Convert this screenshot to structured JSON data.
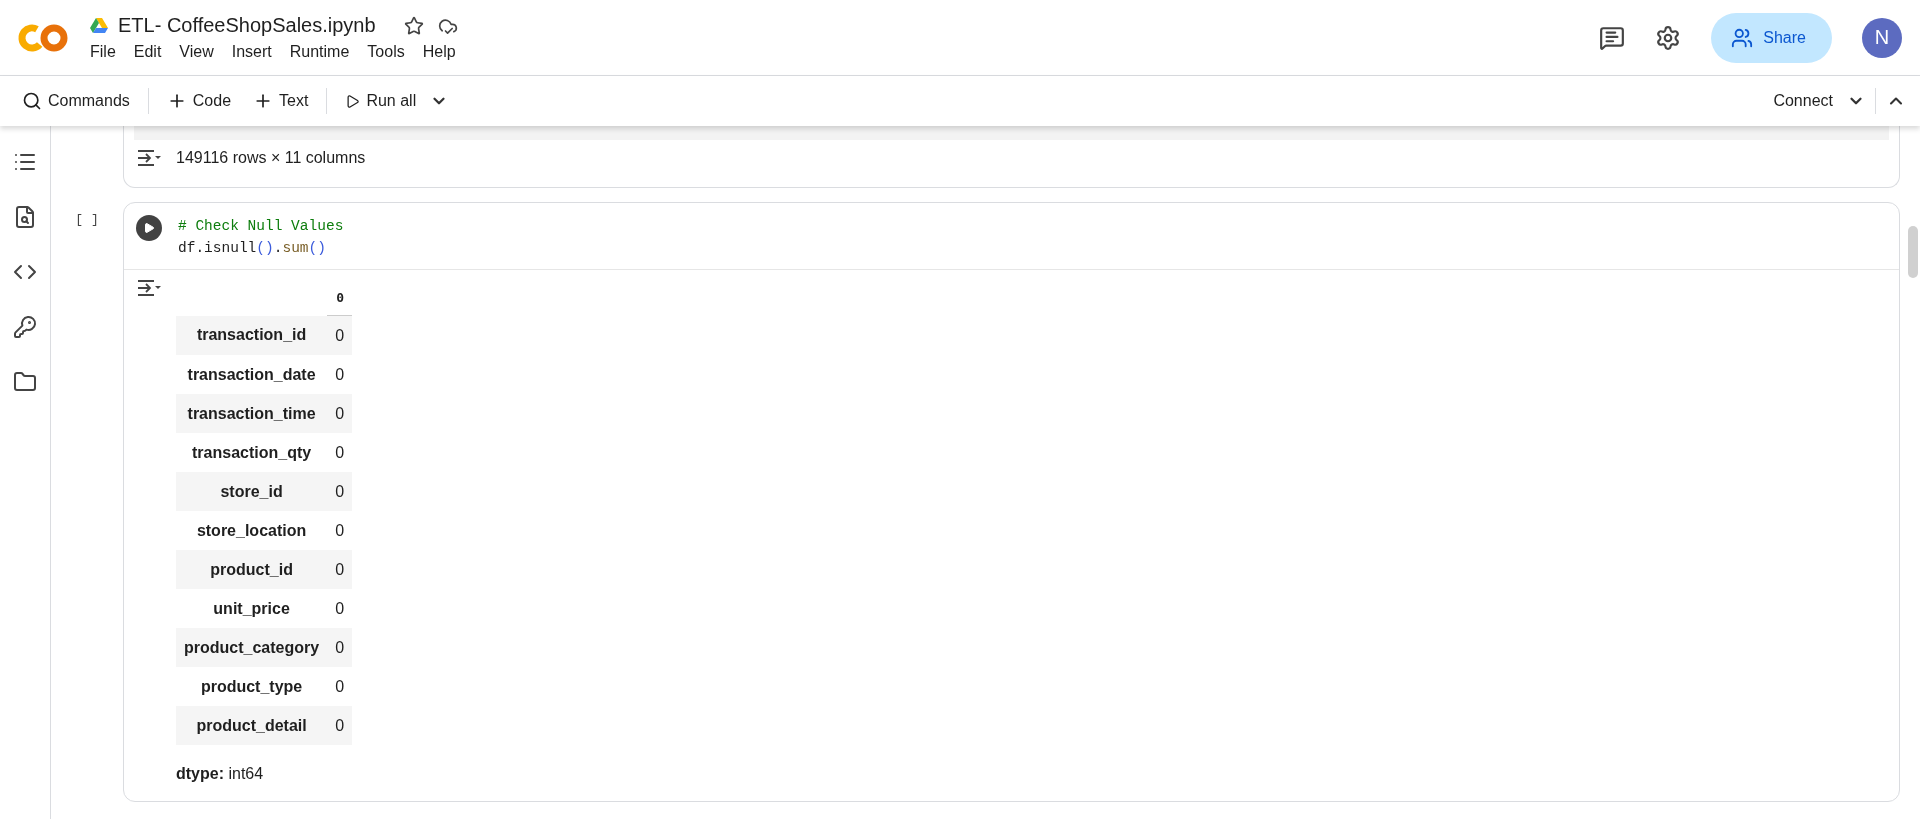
{
  "header": {
    "title": "ETL- CoffeeShopSales.ipynb",
    "starred": false,
    "menu": [
      "File",
      "Edit",
      "View",
      "Insert",
      "Runtime",
      "Tools",
      "Help"
    ],
    "share_label": "Share",
    "avatar_letter": "N"
  },
  "toolbar": {
    "commands": "Commands",
    "add_code": "Code",
    "add_text": "Text",
    "run_all": "Run all",
    "connect": "Connect"
  },
  "previous_output": {
    "summary": "149116 rows × 11 columns"
  },
  "cell": {
    "exec_count": "[ ]",
    "code_lines": [
      [
        {
          "kind": "comment",
          "text": "# Check Null Values"
        }
      ],
      [
        {
          "kind": "plain",
          "text": "df.isnull"
        },
        {
          "kind": "paren",
          "text": "()"
        },
        {
          "kind": "plain",
          "text": "."
        },
        {
          "kind": "func",
          "text": "sum"
        },
        {
          "kind": "paren",
          "text": "()"
        }
      ]
    ],
    "output": {
      "column_header": "0",
      "rows": [
        {
          "label": "transaction_id",
          "value": "0"
        },
        {
          "label": "transaction_date",
          "value": "0"
        },
        {
          "label": "transaction_time",
          "value": "0"
        },
        {
          "label": "transaction_qty",
          "value": "0"
        },
        {
          "label": "store_id",
          "value": "0"
        },
        {
          "label": "store_location",
          "value": "0"
        },
        {
          "label": "product_id",
          "value": "0"
        },
        {
          "label": "unit_price",
          "value": "0"
        },
        {
          "label": "product_category",
          "value": "0"
        },
        {
          "label": "product_type",
          "value": "0"
        },
        {
          "label": "product_detail",
          "value": "0"
        }
      ],
      "dtype_label": "dtype:",
      "dtype_value": "int64"
    }
  }
}
